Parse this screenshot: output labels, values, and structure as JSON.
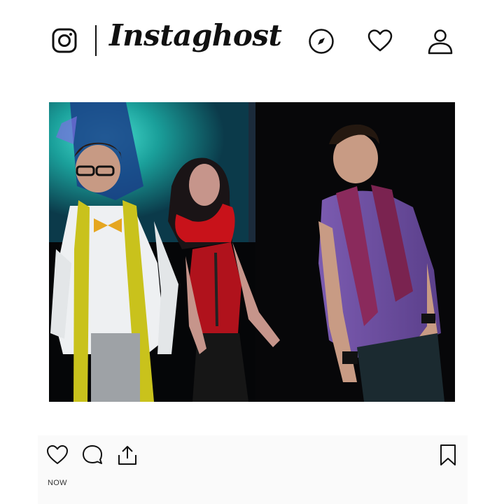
{
  "header": {
    "brand": "Instaghost",
    "icons": [
      "instagram-logo-icon",
      "compass-icon",
      "heart-icon",
      "user-icon"
    ]
  },
  "post": {
    "image_description_icon": "photo",
    "timestamp": "NOW",
    "actions": [
      "heart-icon",
      "comment-icon",
      "share-icon",
      "bookmark-icon"
    ]
  },
  "colors": {
    "background": "#ffffff",
    "footer_background": "#fafafa",
    "icon": "#111111"
  }
}
